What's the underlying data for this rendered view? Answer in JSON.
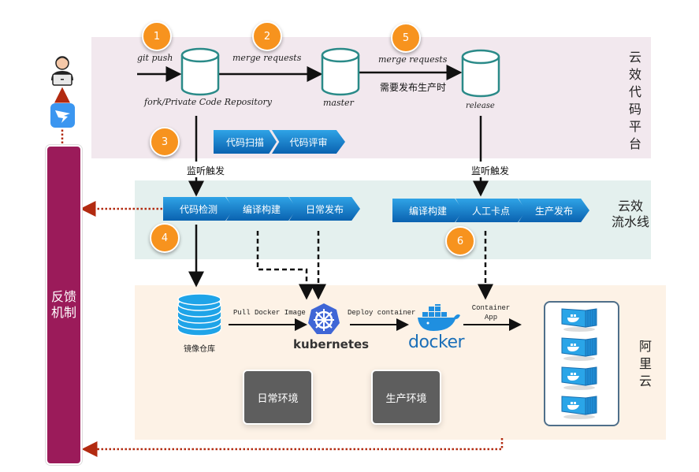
{
  "zones": {
    "code_platform": {
      "label": "云效代码平台"
    },
    "pipeline": {
      "label_line1": "云效",
      "label_line2": "流水线"
    },
    "cloud": {
      "label": "阿里云"
    }
  },
  "feedback": {
    "label_line1": "反馈",
    "label_line2": "机制"
  },
  "user": {
    "icon": "developer-laptop-icon",
    "notifier_icon": "dingtalk-icon"
  },
  "badges": [
    "1",
    "2",
    "3",
    "4",
    "5",
    "6"
  ],
  "repos": {
    "fork": {
      "label": "fork/Private Code Repository"
    },
    "master": {
      "label": "master"
    },
    "release": {
      "label": "release"
    }
  },
  "edges": {
    "git_push": "git push",
    "merge_requests_1": "merge requests",
    "merge_requests_2": "merge requests",
    "release_condition": "需要发布生产时",
    "trigger_left": "监听触发",
    "trigger_right": "监听触发",
    "pull_image": "Pull Docker Image",
    "deploy": "Deploy container",
    "container_app_line1": "Container",
    "container_app_line2": "App"
  },
  "code_review_steps": [
    "代码扫描",
    "代码评审"
  ],
  "daily_pipeline_steps": [
    "代码检测",
    "编译构建",
    "日常发布"
  ],
  "prod_pipeline_steps": [
    "编译构建",
    "人工卡点",
    "生产发布"
  ],
  "cloud": {
    "registry_label": "镜像仓库",
    "kubernetes_label": "kubernetes",
    "docker_label": "docker",
    "environments": [
      "日常环境",
      "生产环境"
    ],
    "container_count": 4
  },
  "colors": {
    "badge": "#f7931e",
    "chevron": "#1a7fd0",
    "feedback": "#9b1b5a",
    "feedback_arrow": "#b22a10",
    "repo_stroke": "#2a8a88",
    "kubernetes": "#3f66d6",
    "docker": "#1f8fe0"
  }
}
